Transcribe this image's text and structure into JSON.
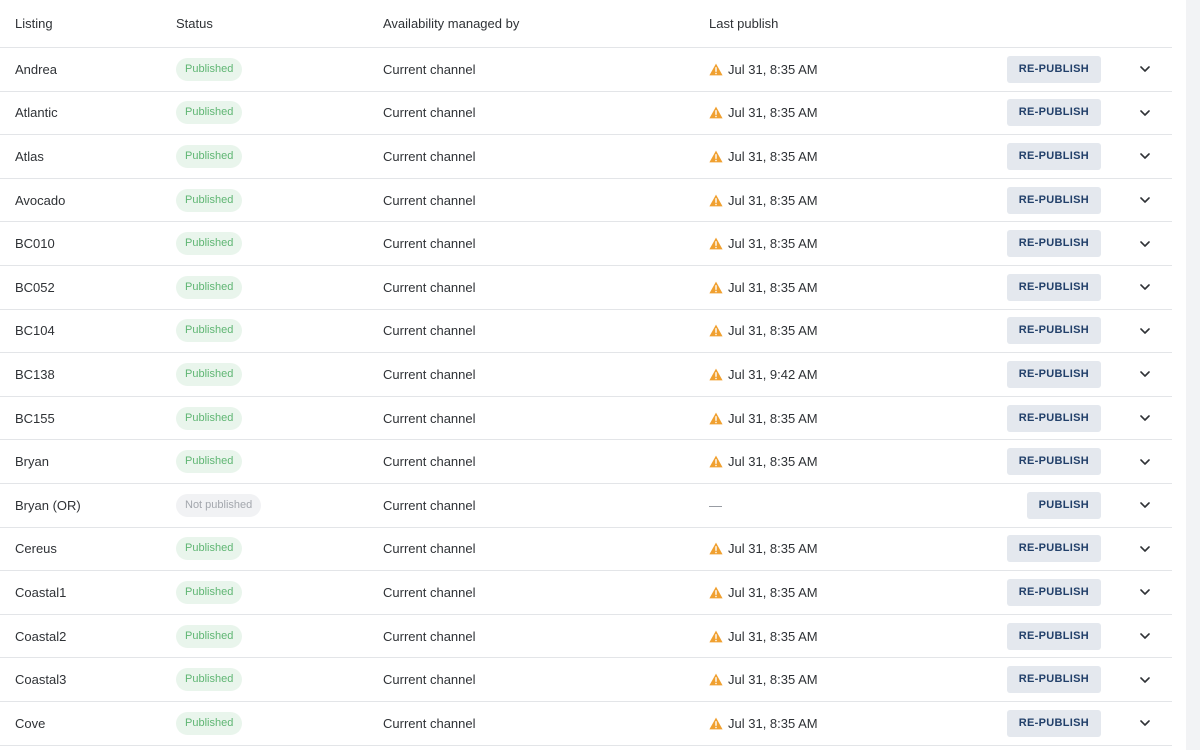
{
  "header": {
    "listing": "Listing",
    "status": "Status",
    "availability": "Availability managed by",
    "last_publish": "Last publish"
  },
  "rows": [
    {
      "listing": "Andrea",
      "status": "Published",
      "status_kind": "published",
      "availability": "Current channel",
      "last_publish": "Jul 31, 8:35 AM",
      "warning": true,
      "action": "RE-PUBLISH"
    },
    {
      "listing": "Atlantic",
      "status": "Published",
      "status_kind": "published",
      "availability": "Current channel",
      "last_publish": "Jul 31, 8:35 AM",
      "warning": true,
      "action": "RE-PUBLISH"
    },
    {
      "listing": "Atlas",
      "status": "Published",
      "status_kind": "published",
      "availability": "Current channel",
      "last_publish": "Jul 31, 8:35 AM",
      "warning": true,
      "action": "RE-PUBLISH"
    },
    {
      "listing": "Avocado",
      "status": "Published",
      "status_kind": "published",
      "availability": "Current channel",
      "last_publish": "Jul 31, 8:35 AM",
      "warning": true,
      "action": "RE-PUBLISH"
    },
    {
      "listing": "BC010",
      "status": "Published",
      "status_kind": "published",
      "availability": "Current channel",
      "last_publish": "Jul 31, 8:35 AM",
      "warning": true,
      "action": "RE-PUBLISH"
    },
    {
      "listing": "BC052",
      "status": "Published",
      "status_kind": "published",
      "availability": "Current channel",
      "last_publish": "Jul 31, 8:35 AM",
      "warning": true,
      "action": "RE-PUBLISH"
    },
    {
      "listing": "BC104",
      "status": "Published",
      "status_kind": "published",
      "availability": "Current channel",
      "last_publish": "Jul 31, 8:35 AM",
      "warning": true,
      "action": "RE-PUBLISH"
    },
    {
      "listing": "BC138",
      "status": "Published",
      "status_kind": "published",
      "availability": "Current channel",
      "last_publish": "Jul 31, 9:42 AM",
      "warning": true,
      "action": "RE-PUBLISH"
    },
    {
      "listing": "BC155",
      "status": "Published",
      "status_kind": "published",
      "availability": "Current channel",
      "last_publish": "Jul 31, 8:35 AM",
      "warning": true,
      "action": "RE-PUBLISH"
    },
    {
      "listing": "Bryan",
      "status": "Published",
      "status_kind": "published",
      "availability": "Current channel",
      "last_publish": "Jul 31, 8:35 AM",
      "warning": true,
      "action": "RE-PUBLISH"
    },
    {
      "listing": "Bryan (OR)",
      "status": "Not published",
      "status_kind": "unpublished",
      "availability": "Current channel",
      "last_publish": "—",
      "warning": false,
      "action": "PUBLISH"
    },
    {
      "listing": "Cereus",
      "status": "Published",
      "status_kind": "published",
      "availability": "Current channel",
      "last_publish": "Jul 31, 8:35 AM",
      "warning": true,
      "action": "RE-PUBLISH"
    },
    {
      "listing": "Coastal1",
      "status": "Published",
      "status_kind": "published",
      "availability": "Current channel",
      "last_publish": "Jul 31, 8:35 AM",
      "warning": true,
      "action": "RE-PUBLISH"
    },
    {
      "listing": "Coastal2",
      "status": "Published",
      "status_kind": "published",
      "availability": "Current channel",
      "last_publish": "Jul 31, 8:35 AM",
      "warning": true,
      "action": "RE-PUBLISH"
    },
    {
      "listing": "Coastal3",
      "status": "Published",
      "status_kind": "published",
      "availability": "Current channel",
      "last_publish": "Jul 31, 8:35 AM",
      "warning": true,
      "action": "RE-PUBLISH"
    },
    {
      "listing": "Cove",
      "status": "Published",
      "status_kind": "published",
      "availability": "Current channel",
      "last_publish": "Jul 31, 8:35 AM",
      "warning": true,
      "action": "RE-PUBLISH"
    }
  ],
  "colors": {
    "warning": "#f0a030",
    "published_text": "#5fb673",
    "published_bg": "#e9f5ec",
    "button_text": "#22406a",
    "button_bg": "#e4e8ee"
  }
}
